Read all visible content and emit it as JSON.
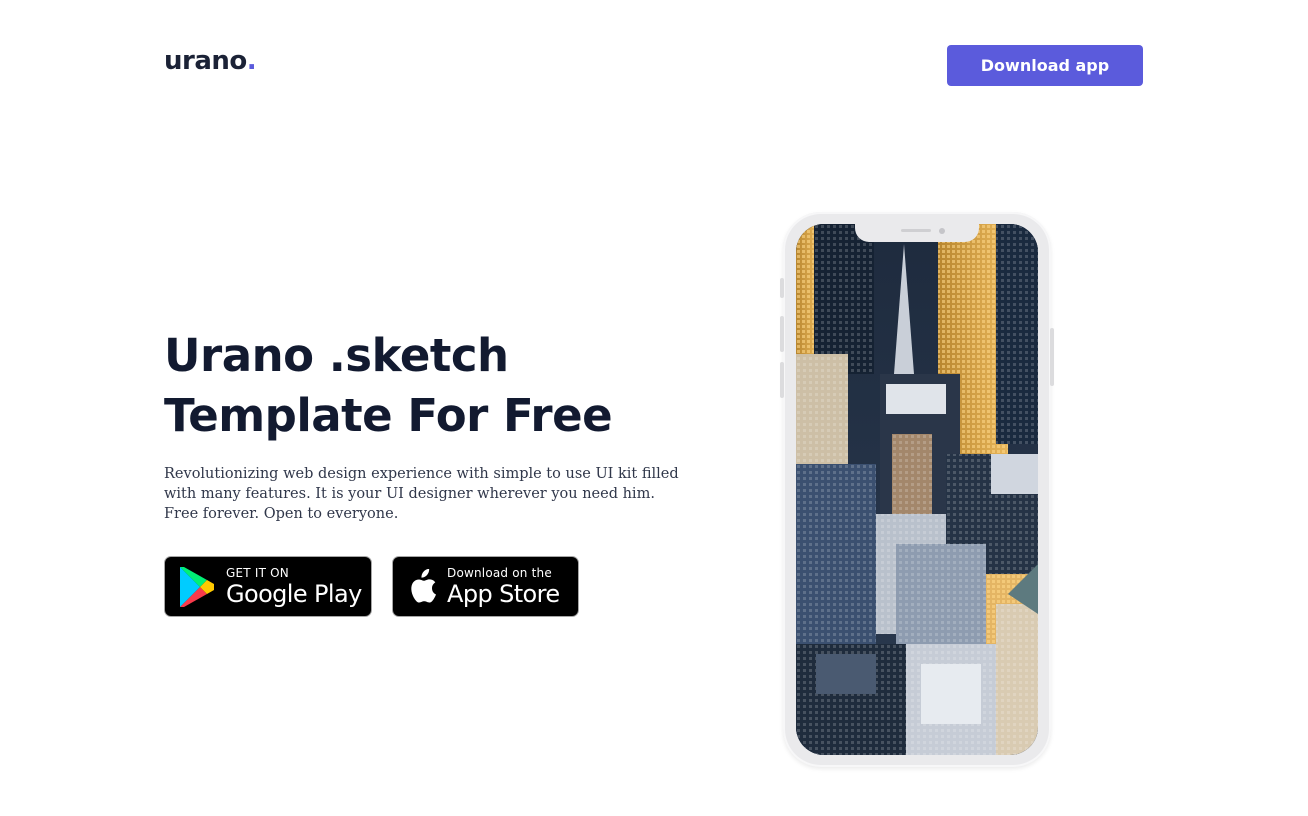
{
  "header": {
    "logo_text": "urano",
    "logo_dot": ".",
    "download_label": "Download app"
  },
  "hero": {
    "title_line1": "Urano .sketch",
    "title_line2": "Template For Free",
    "description": "Revolutionizing web design experience with simple to use UI kit filled with many features. It is your UI designer wherever you need him. Free forever. Open to everyone."
  },
  "stores": {
    "google_small": "GET IT ON",
    "google_big": "Google Play",
    "apple_small": "Download on the",
    "apple_big": "App Store"
  },
  "colors": {
    "accent": "#5b5bdc",
    "heading": "#121a30",
    "body_text": "#30374a",
    "badge_bg": "#000000"
  },
  "icons": {
    "google_play": "google-play-icon",
    "apple": "apple-icon"
  }
}
